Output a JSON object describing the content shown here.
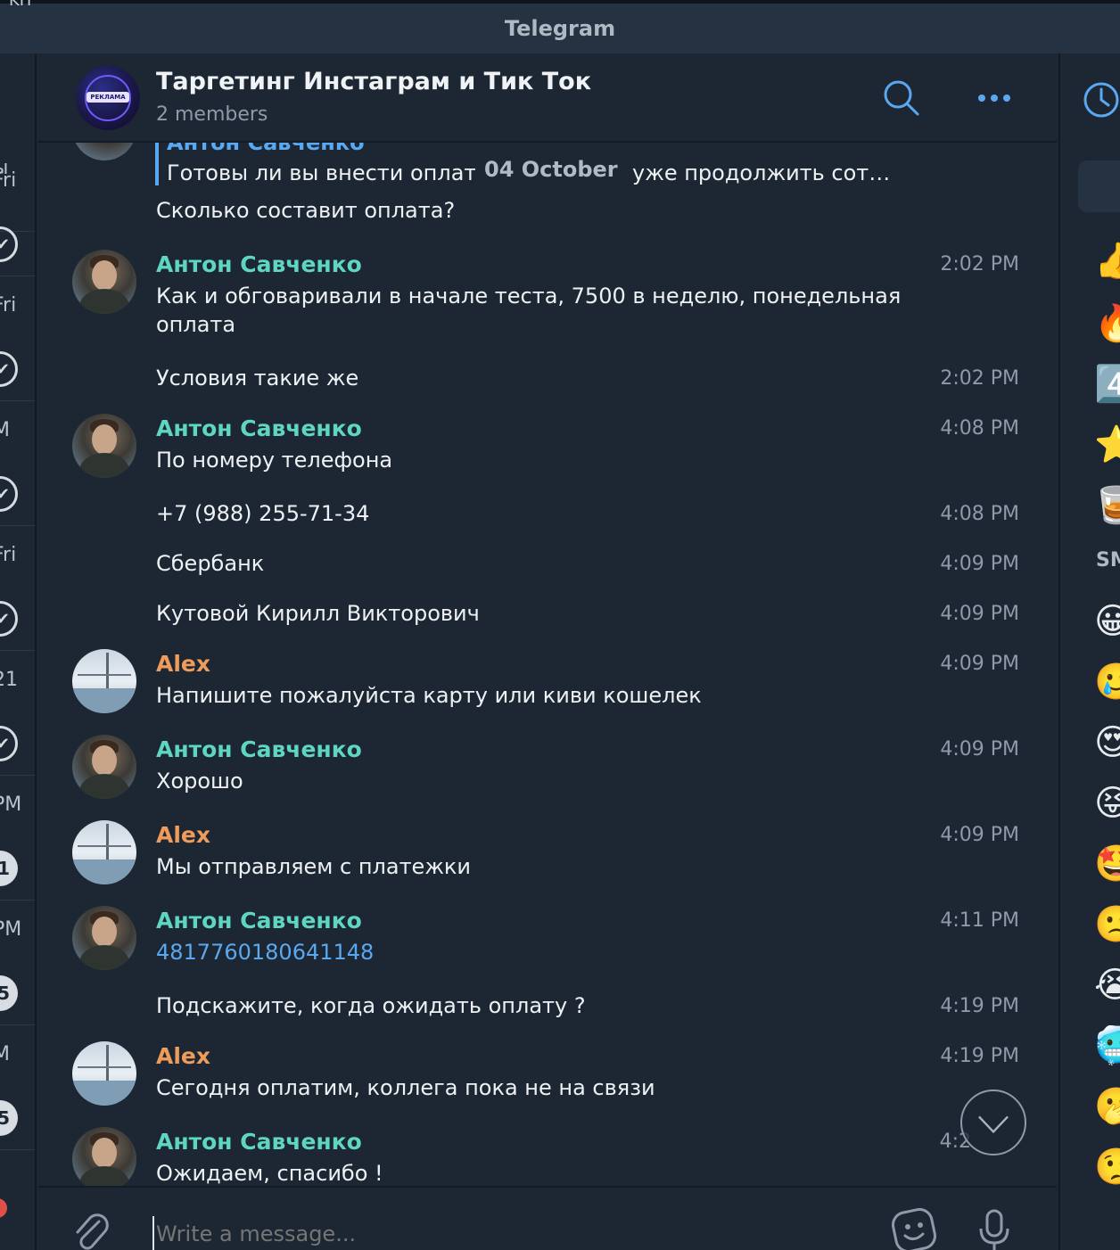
{
  "window": {
    "title": "Telegram",
    "top_fragment": "KH"
  },
  "left_strip": {
    "rows": [
      {
        "text": "ы",
        "icon": "pin-icon",
        "badge": ""
      },
      {
        "text": "Fri",
        "icon": "pin-icon",
        "badge": ""
      },
      {
        "text": "Fri",
        "icon": "pin-icon",
        "badge": ""
      },
      {
        "text": "M",
        "icon": "pin-icon",
        "badge": ""
      },
      {
        "text": "Fri",
        "icon": "pin-icon",
        "badge": ""
      },
      {
        "text": "21",
        "icon": "pin-icon",
        "badge": ""
      },
      {
        "text": "PM",
        "icon": "",
        "badge": "1"
      },
      {
        "text": "PM",
        "icon": "",
        "badge": "5"
      },
      {
        "text": "M",
        "icon": "",
        "badge": "5"
      }
    ]
  },
  "header": {
    "title": "Таргетинг Инстаграм и Тик Ток",
    "subtitle": "2 members",
    "avatar_label": "РЕКЛАМА"
  },
  "reply": {
    "author": "Антон Савченко",
    "text": "Готовы ли вы внести оплат",
    "text_tail": "уже продолжить сот…",
    "date_pill": "04 October"
  },
  "messages": [
    {
      "author": "",
      "text": "Сколько составит оплата?",
      "time": "",
      "is_link": false
    },
    {
      "author": "Антон Савченко",
      "author_kind": "anton",
      "text": "Как и обговаривали в начале теста, 7500 в неделю, понедельная",
      "text2": "оплата",
      "time": "2:02 PM"
    },
    {
      "author": "",
      "text": "Условия такие же",
      "time": "2:02 PM"
    },
    {
      "author": "Антон Савченко",
      "author_kind": "anton",
      "text": "По номеру телефона",
      "time": "4:08 PM"
    },
    {
      "author": "",
      "text": "+7 (988) 255-71-34",
      "time": "4:08 PM"
    },
    {
      "author": "",
      "text": "Сбербанк",
      "time": "4:09 PM"
    },
    {
      "author": "",
      "text": "Кутовой Кирилл Викторович",
      "time": "4:09 PM"
    },
    {
      "author": "Alex",
      "author_kind": "alex",
      "text": "Напишите пожалуйста карту или киви кошелек",
      "time": "4:09 PM"
    },
    {
      "author": "Антон Савченко",
      "author_kind": "anton",
      "text": "Хорошо",
      "time": "4:09 PM"
    },
    {
      "author": "Alex",
      "author_kind": "alex",
      "text": "Мы отправляем с платежки",
      "time": "4:09 PM"
    },
    {
      "author": "Антон Савченко",
      "author_kind": "anton",
      "text": "4817760180641148",
      "time": "4:11 PM"
    },
    {
      "author": "",
      "text": "Подскажите, когда ожидать оплату ?",
      "time": "4:19 PM"
    },
    {
      "author": "Alex",
      "author_kind": "alex",
      "text": "Сегодня оплатим, коллега пока не на связи",
      "time": "4:19 PM"
    },
    {
      "author": "Антон Савченко",
      "author_kind": "anton",
      "text": "Ожидаем, спасибо !",
      "time": "4:2"
    }
  ],
  "composer": {
    "placeholder": "Write a message..."
  },
  "right_panel": {
    "section_label": "SM",
    "emojis": [
      "👍",
      "🔥",
      "4️⃣",
      "⭐",
      "🥃",
      "😀",
      "🥲",
      "😍",
      "😝",
      "🤩",
      "🙁",
      "😭",
      "🥶",
      "🫢",
      "🤥"
    ]
  },
  "colors": {
    "background": "#1c2733",
    "accent": "#5aa8f0",
    "name_anton": "#5fd6bf",
    "name_alex": "#ef9c5a",
    "muted": "#8e9aa7"
  }
}
